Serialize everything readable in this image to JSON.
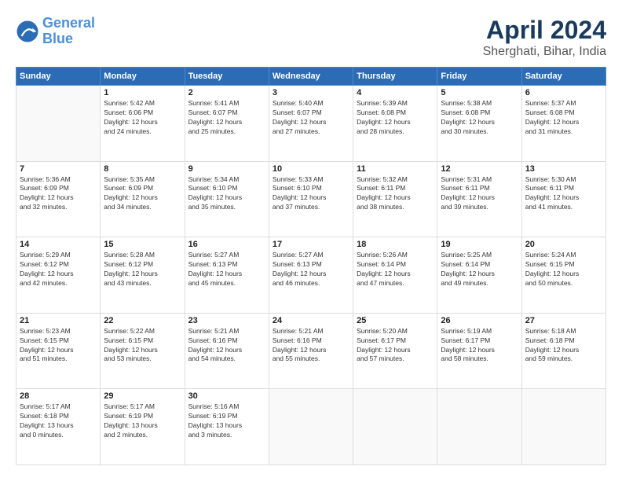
{
  "logo": {
    "line1": "General",
    "line2": "Blue"
  },
  "title": "April 2024",
  "subtitle": "Sherghati, Bihar, India",
  "headers": [
    "Sunday",
    "Monday",
    "Tuesday",
    "Wednesday",
    "Thursday",
    "Friday",
    "Saturday"
  ],
  "weeks": [
    [
      {
        "day": "",
        "info": ""
      },
      {
        "day": "1",
        "info": "Sunrise: 5:42 AM\nSunset: 6:06 PM\nDaylight: 12 hours\nand 24 minutes."
      },
      {
        "day": "2",
        "info": "Sunrise: 5:41 AM\nSunset: 6:07 PM\nDaylight: 12 hours\nand 25 minutes."
      },
      {
        "day": "3",
        "info": "Sunrise: 5:40 AM\nSunset: 6:07 PM\nDaylight: 12 hours\nand 27 minutes."
      },
      {
        "day": "4",
        "info": "Sunrise: 5:39 AM\nSunset: 6:08 PM\nDaylight: 12 hours\nand 28 minutes."
      },
      {
        "day": "5",
        "info": "Sunrise: 5:38 AM\nSunset: 6:08 PM\nDaylight: 12 hours\nand 30 minutes."
      },
      {
        "day": "6",
        "info": "Sunrise: 5:37 AM\nSunset: 6:08 PM\nDaylight: 12 hours\nand 31 minutes."
      }
    ],
    [
      {
        "day": "7",
        "info": "Sunrise: 5:36 AM\nSunset: 6:09 PM\nDaylight: 12 hours\nand 32 minutes."
      },
      {
        "day": "8",
        "info": "Sunrise: 5:35 AM\nSunset: 6:09 PM\nDaylight: 12 hours\nand 34 minutes."
      },
      {
        "day": "9",
        "info": "Sunrise: 5:34 AM\nSunset: 6:10 PM\nDaylight: 12 hours\nand 35 minutes."
      },
      {
        "day": "10",
        "info": "Sunrise: 5:33 AM\nSunset: 6:10 PM\nDaylight: 12 hours\nand 37 minutes."
      },
      {
        "day": "11",
        "info": "Sunrise: 5:32 AM\nSunset: 6:11 PM\nDaylight: 12 hours\nand 38 minutes."
      },
      {
        "day": "12",
        "info": "Sunrise: 5:31 AM\nSunset: 6:11 PM\nDaylight: 12 hours\nand 39 minutes."
      },
      {
        "day": "13",
        "info": "Sunrise: 5:30 AM\nSunset: 6:11 PM\nDaylight: 12 hours\nand 41 minutes."
      }
    ],
    [
      {
        "day": "14",
        "info": "Sunrise: 5:29 AM\nSunset: 6:12 PM\nDaylight: 12 hours\nand 42 minutes."
      },
      {
        "day": "15",
        "info": "Sunrise: 5:28 AM\nSunset: 6:12 PM\nDaylight: 12 hours\nand 43 minutes."
      },
      {
        "day": "16",
        "info": "Sunrise: 5:27 AM\nSunset: 6:13 PM\nDaylight: 12 hours\nand 45 minutes."
      },
      {
        "day": "17",
        "info": "Sunrise: 5:27 AM\nSunset: 6:13 PM\nDaylight: 12 hours\nand 46 minutes."
      },
      {
        "day": "18",
        "info": "Sunrise: 5:26 AM\nSunset: 6:14 PM\nDaylight: 12 hours\nand 47 minutes."
      },
      {
        "day": "19",
        "info": "Sunrise: 5:25 AM\nSunset: 6:14 PM\nDaylight: 12 hours\nand 49 minutes."
      },
      {
        "day": "20",
        "info": "Sunrise: 5:24 AM\nSunset: 6:15 PM\nDaylight: 12 hours\nand 50 minutes."
      }
    ],
    [
      {
        "day": "21",
        "info": "Sunrise: 5:23 AM\nSunset: 6:15 PM\nDaylight: 12 hours\nand 51 minutes."
      },
      {
        "day": "22",
        "info": "Sunrise: 5:22 AM\nSunset: 6:15 PM\nDaylight: 12 hours\nand 53 minutes."
      },
      {
        "day": "23",
        "info": "Sunrise: 5:21 AM\nSunset: 6:16 PM\nDaylight: 12 hours\nand 54 minutes."
      },
      {
        "day": "24",
        "info": "Sunrise: 5:21 AM\nSunset: 6:16 PM\nDaylight: 12 hours\nand 55 minutes."
      },
      {
        "day": "25",
        "info": "Sunrise: 5:20 AM\nSunset: 6:17 PM\nDaylight: 12 hours\nand 57 minutes."
      },
      {
        "day": "26",
        "info": "Sunrise: 5:19 AM\nSunset: 6:17 PM\nDaylight: 12 hours\nand 58 minutes."
      },
      {
        "day": "27",
        "info": "Sunrise: 5:18 AM\nSunset: 6:18 PM\nDaylight: 12 hours\nand 59 minutes."
      }
    ],
    [
      {
        "day": "28",
        "info": "Sunrise: 5:17 AM\nSunset: 6:18 PM\nDaylight: 13 hours\nand 0 minutes."
      },
      {
        "day": "29",
        "info": "Sunrise: 5:17 AM\nSunset: 6:19 PM\nDaylight: 13 hours\nand 2 minutes."
      },
      {
        "day": "30",
        "info": "Sunrise: 5:16 AM\nSunset: 6:19 PM\nDaylight: 13 hours\nand 3 minutes."
      },
      {
        "day": "",
        "info": ""
      },
      {
        "day": "",
        "info": ""
      },
      {
        "day": "",
        "info": ""
      },
      {
        "day": "",
        "info": ""
      }
    ]
  ]
}
